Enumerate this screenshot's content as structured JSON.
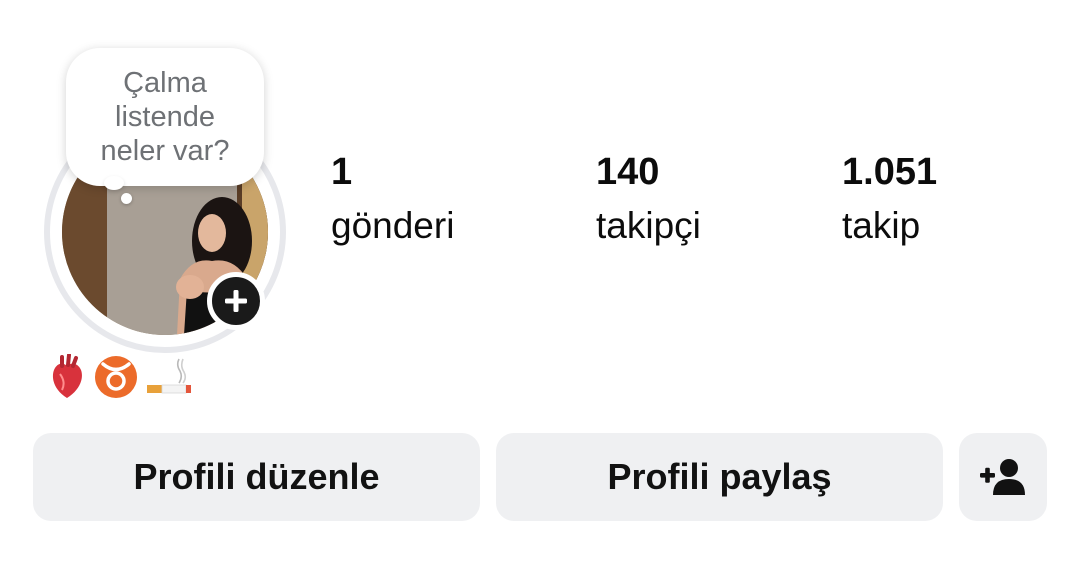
{
  "profile": {
    "note": "Çalma\nlistende\nneler var?",
    "avatar_icon": "profile-photo",
    "add_story_icon": "plus-icon"
  },
  "stats": [
    {
      "value": "1",
      "label": "gönderi"
    },
    {
      "value": "140",
      "label": "takipçi"
    },
    {
      "value": "1.051",
      "label": "takip"
    }
  ],
  "bio": {
    "emojis": [
      "anatomical-heart",
      "taurus-sign",
      "cigarette"
    ]
  },
  "actions": {
    "edit_profile": "Profili düzenle",
    "share_profile": "Profili paylaş",
    "discover_people_icon": "add-person-icon"
  }
}
